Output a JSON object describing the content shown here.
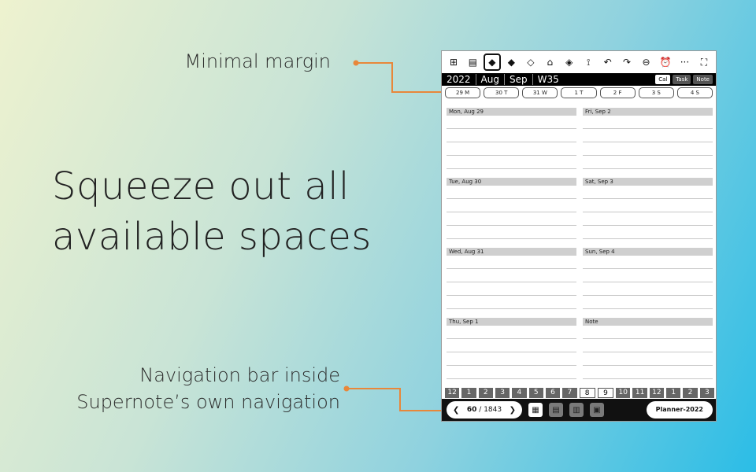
{
  "callouts": {
    "margin": "Minimal margin",
    "headline_line1": "Squeeze out all",
    "headline_line2": "available spaces",
    "nav_line1": "Navigation bar inside",
    "nav_line2": "Supernote’s own navigation"
  },
  "colors": {
    "accent": "#e8873a",
    "background_start": "#eef2cf",
    "background_end": "#2bbde6"
  },
  "toolbar": {
    "tools": [
      {
        "name": "layout-grid-icon",
        "glyph": "⊞"
      },
      {
        "name": "list-view-icon",
        "glyph": "▤"
      },
      {
        "name": "pen-icon",
        "glyph": "◆",
        "active": true
      },
      {
        "name": "pen-alt-icon",
        "glyph": "◆"
      },
      {
        "name": "marker-icon",
        "glyph": "◇"
      },
      {
        "name": "highlighter-icon",
        "glyph": "⌂"
      },
      {
        "name": "eraser-icon",
        "glyph": "◈"
      },
      {
        "name": "lasso-icon",
        "glyph": "⟟"
      },
      {
        "name": "undo-icon",
        "glyph": "↶"
      },
      {
        "name": "redo-icon",
        "glyph": "↷"
      },
      {
        "name": "back-circle-icon",
        "glyph": "⊖"
      },
      {
        "name": "alarm-icon",
        "glyph": "⏰"
      },
      {
        "name": "more-icon",
        "glyph": "···"
      },
      {
        "name": "fullscreen-icon",
        "glyph": "⛶"
      }
    ]
  },
  "datebar": {
    "year": "2022",
    "month1": "Aug",
    "month2": "Sep",
    "week": "W35",
    "tab_cal": "Cal",
    "tab_task": "Task",
    "tab_note": "Note"
  },
  "days": [
    "29 M",
    "30 T",
    "31 W",
    "1 T",
    "2 F",
    "3 S",
    "4 S"
  ],
  "cells": {
    "left": [
      "Mon, Aug 29",
      "Tue, Aug 30",
      "Wed, Aug 31",
      "Thu, Sep 1"
    ],
    "right": [
      "Fri, Sep 2",
      "Sat, Sep 3",
      "Sun, Sep 4",
      "Note"
    ]
  },
  "months": [
    "12",
    "1",
    "2",
    "3",
    "4",
    "5",
    "6",
    "7",
    "8",
    "9",
    "10",
    "11",
    "12",
    "1",
    "2",
    "3"
  ],
  "navbar": {
    "page_current": "60",
    "page_total": "/ 1843",
    "planner": "Planner-2022"
  }
}
